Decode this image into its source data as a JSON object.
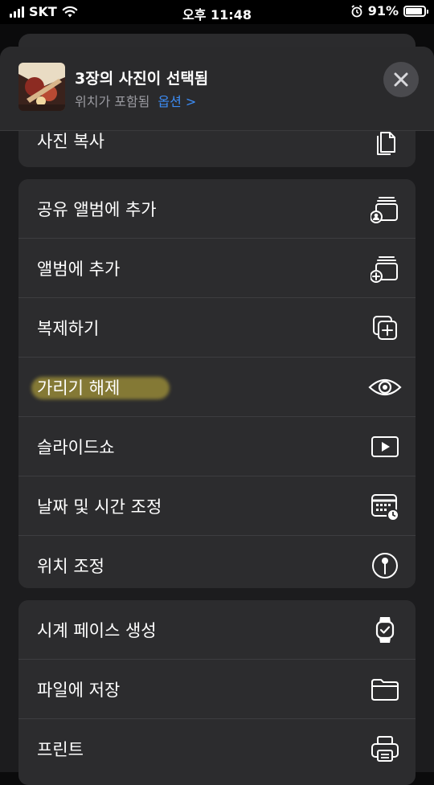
{
  "status_bar": {
    "carrier": "SKT",
    "time": "오후 11:48",
    "battery_percent": "91%",
    "battery_level": 0.91
  },
  "header": {
    "title": "3장의 사진이 선택됨",
    "subtitle": "위치가 포함됨",
    "options_label": "옵션 >"
  },
  "groups": [
    {
      "items": [
        {
          "label": "사진 복사",
          "icon": "copy-photo-icon"
        }
      ]
    },
    {
      "items": [
        {
          "label": "공유 앨범에 추가",
          "icon": "shared-album-icon"
        },
        {
          "label": "앨범에 추가",
          "icon": "add-album-icon"
        },
        {
          "label": "복제하기",
          "icon": "duplicate-icon"
        },
        {
          "label": "가리기 해제",
          "icon": "eye-icon",
          "highlighted": true
        },
        {
          "label": "슬라이드쇼",
          "icon": "play-icon"
        },
        {
          "label": "날짜 및 시간 조정",
          "icon": "calendar-clock-icon"
        },
        {
          "label": "위치 조정",
          "icon": "location-pin-icon"
        }
      ]
    },
    {
      "items": [
        {
          "label": "시계 페이스 생성",
          "icon": "watch-icon"
        },
        {
          "label": "파일에 저장",
          "icon": "folder-icon"
        },
        {
          "label": "프린트",
          "icon": "printer-icon"
        }
      ]
    }
  ],
  "colors": {
    "accent": "#3c8cf5",
    "highlight": "#cdb93c"
  }
}
